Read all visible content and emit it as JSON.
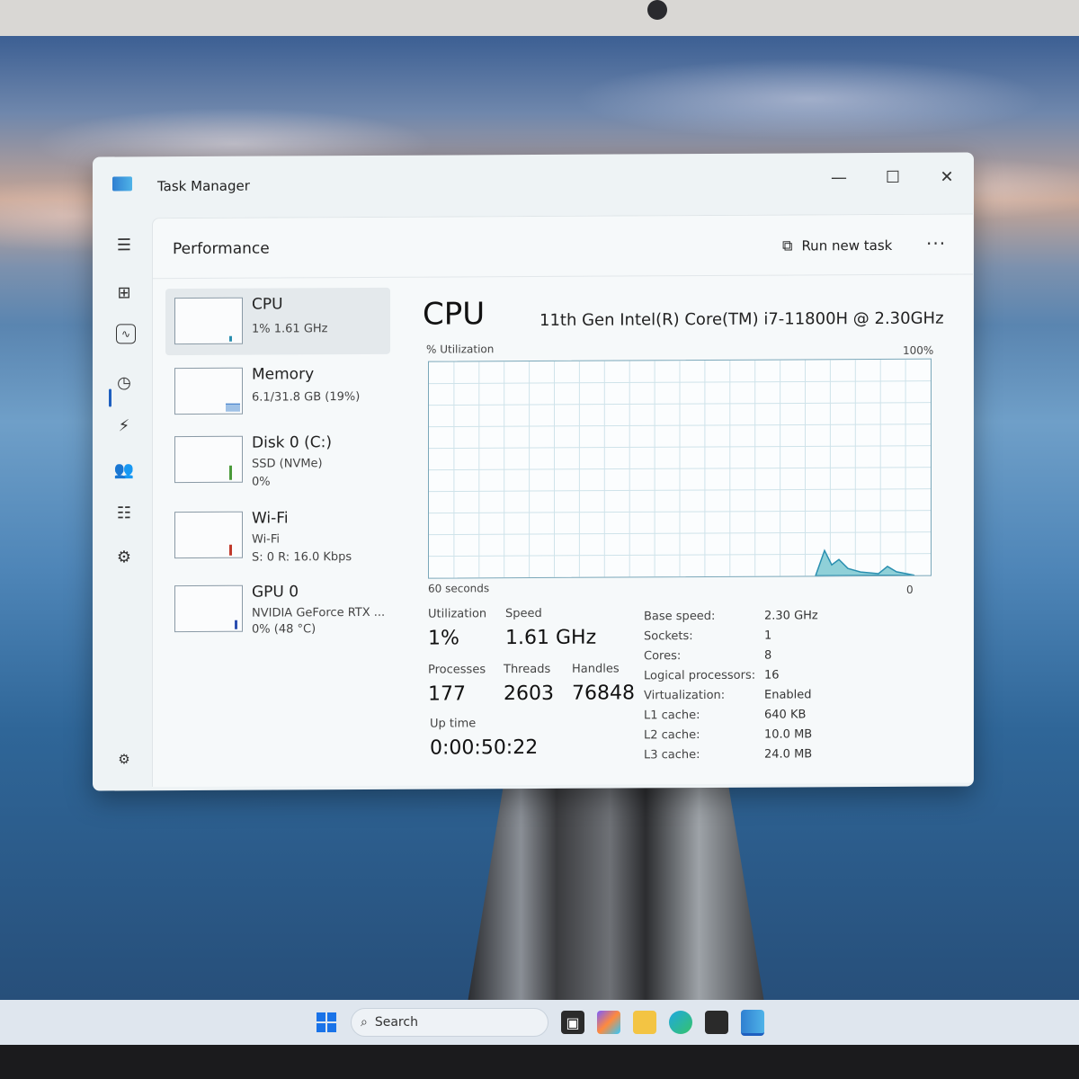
{
  "window": {
    "title": "Task Manager"
  },
  "window_controls": {
    "minimize": "—",
    "maximize": "☐",
    "close": "✕"
  },
  "page": {
    "title": "Performance",
    "run_new_task": "Run new task",
    "more": "···"
  },
  "devices": [
    {
      "name": "CPU",
      "sub1": "1%  1.61 GHz",
      "sub2": ""
    },
    {
      "name": "Memory",
      "sub1": "6.1/31.8 GB (19%)",
      "sub2": ""
    },
    {
      "name": "Disk 0 (C:)",
      "sub1": "SSD (NVMe)",
      "sub2": "0%"
    },
    {
      "name": "Wi-Fi",
      "sub1": "Wi-Fi",
      "sub2": "S: 0 R: 16.0 Kbps"
    },
    {
      "name": "GPU 0",
      "sub1": "NVIDIA GeForce RTX ...",
      "sub2": "0% (48 °C)"
    }
  ],
  "cpu": {
    "heading": "CPU",
    "model": "11th Gen Intel(R) Core(TM) i7-11800H @ 2.30GHz",
    "graph_label": "% Utilization",
    "graph_max": "100%",
    "graph_time": "60 seconds",
    "graph_min": "0",
    "utilization_label": "Utilization",
    "utilization": "1%",
    "speed_label": "Speed",
    "speed": "1.61 GHz",
    "processes_label": "Processes",
    "processes": "177",
    "threads_label": "Threads",
    "threads": "2603",
    "handles_label": "Handles",
    "handles": "76848",
    "uptime_label": "Up time",
    "uptime": "0:00:50:22",
    "specs": [
      {
        "label": "Base speed:",
        "value": "2.30 GHz"
      },
      {
        "label": "Sockets:",
        "value": "1"
      },
      {
        "label": "Cores:",
        "value": "8"
      },
      {
        "label": "Logical processors:",
        "value": "16"
      },
      {
        "label": "Virtualization:",
        "value": "Enabled"
      },
      {
        "label": "L1 cache:",
        "value": "640 KB"
      },
      {
        "label": "L2 cache:",
        "value": "10.0 MB"
      },
      {
        "label": "L3 cache:",
        "value": "24.0 MB"
      }
    ]
  },
  "taskbar": {
    "search": "Search"
  },
  "colors": {
    "graph_line": "#2a8fb0",
    "graph_fill": "#8fd0d8",
    "accent": "#1f5fbf"
  }
}
